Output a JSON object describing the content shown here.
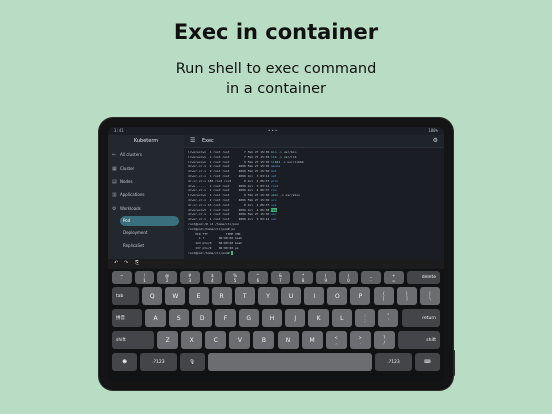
{
  "headline": "Exec in container",
  "subline": [
    "Run shell to exec command",
    "in a container"
  ],
  "status": {
    "time": "3:41",
    "battery": "100%"
  },
  "sidebar": {
    "title": "Kubeterm",
    "items": [
      {
        "icon": "←",
        "label": "All clusters",
        "sub": false
      },
      {
        "icon": "▦",
        "label": "Cluster",
        "sub": false
      },
      {
        "icon": "▤",
        "label": "Nodes",
        "sub": false
      },
      {
        "icon": "▥",
        "label": "Applications",
        "sub": false
      },
      {
        "icon": "⚙",
        "label": "Workloads",
        "sub": false
      },
      {
        "icon": "",
        "label": "Pod",
        "sub": true,
        "active": true
      },
      {
        "icon": "",
        "label": "Deployment",
        "sub": true
      },
      {
        "icon": "",
        "label": "ReplicaSet",
        "sub": true
      }
    ]
  },
  "terminal": {
    "title": "Exec",
    "lines": [
      [
        {
          "t": "lrwxrwxrwx  1 root root        7 Feb 27 15:30 "
        },
        {
          "t": "bin",
          "c": "cyan"
        },
        {
          "t": " -> usr/bin"
        }
      ],
      [
        {
          "t": "lrwxrwxrwx  1 root root        7 Feb 27 15:30 "
        },
        {
          "t": "lib",
          "c": "cyan"
        },
        {
          "t": " -> usr/lib"
        }
      ],
      [
        {
          "t": "lrwxrwxrwx  1 root root        9 Feb 27 15:30 "
        },
        {
          "t": "lib64",
          "c": "cyan"
        },
        {
          "t": " -> usr/lib64"
        }
      ],
      [
        {
          "t": "drwxr-xr-x  2 root root     4096 Feb 27 15:30 "
        },
        {
          "t": "media",
          "c": "blue"
        }
      ],
      [
        {
          "t": "drwxr-xr-x  2 root root     4096 Feb 27 15:30 "
        },
        {
          "t": "mnt",
          "c": "blue"
        }
      ],
      [
        {
          "t": "drwxr-xr-x  1 root root     4096 Jul  3 03:14 "
        },
        {
          "t": "opt",
          "c": "blue"
        }
      ],
      [
        {
          "t": "dr-xr-xr-x 185 root root       0 Jul  4 06:37 "
        },
        {
          "t": "proc",
          "c": "blue"
        }
      ],
      [
        {
          "t": "drwx------  1 root root     4096 Jul  3 03:14 "
        },
        {
          "t": "root",
          "c": "blue"
        }
      ],
      [
        {
          "t": "drwxr-xr-x  1 root root     4096 Jul  4 06:37 "
        },
        {
          "t": "run",
          "c": "blue"
        }
      ],
      [
        {
          "t": "lrwxrwxrwx  1 root root        8 Feb 27 15:30 "
        },
        {
          "t": "sbin",
          "c": "cyan"
        },
        {
          "t": " -> usr/sbin"
        }
      ],
      [
        {
          "t": "drwxr-xr-x  2 root root     4096 Feb 27 15:30 "
        },
        {
          "t": "srv",
          "c": "blue"
        }
      ],
      [
        {
          "t": "dr-xr-xr-x 13 root root        0 Jul  4 06:37 "
        },
        {
          "t": "sys",
          "c": "blue"
        }
      ],
      [
        {
          "t": "drwxrwxrwt  1 root root     4096 Jul  4 06:38 "
        },
        {
          "t": "tmp",
          "c": "hl"
        }
      ],
      [
        {
          "t": "drwxr-xr-x  1 root root     4096 Feb 27 15:30 "
        },
        {
          "t": "usr",
          "c": "blue"
        }
      ],
      [
        {
          "t": "drwxr-xr-x  1 root root     4096 Jul  3 03:14 "
        },
        {
          "t": "var",
          "c": "blue"
        }
      ],
      [
        {
          "t": "root@pod:/# cd /home/cli/pod"
        }
      ],
      [
        {
          "t": "root@pod:/home/cli/pod# ps"
        }
      ],
      [
        {
          "t": "    PID TTY          TIME CMD"
        }
      ],
      [
        {
          "t": "      1 ?        00:00:00 bash"
        }
      ],
      [
        {
          "t": "    124 pts/0    00:00:00 bash"
        }
      ],
      [
        {
          "t": "    137 pts/0    00:00:00 ps"
        }
      ],
      [
        {
          "t": "root@pod:/home/cli/pod# "
        },
        {
          "t": " ",
          "c": "hl"
        }
      ]
    ]
  },
  "keyboard": {
    "toolbar": [
      "↶",
      "↷",
      "⎘"
    ],
    "rows": [
      [
        [
          "~",
          "`"
        ],
        [
          "!",
          "1"
        ],
        [
          "@",
          "2"
        ],
        [
          "#",
          "3"
        ],
        [
          "$",
          "4"
        ],
        [
          "%",
          "5"
        ],
        [
          "^",
          "6"
        ],
        [
          "&",
          "7"
        ],
        [
          "*",
          "8"
        ],
        [
          "(",
          "9"
        ],
        [
          ")",
          "0"
        ],
        [
          "_",
          "-"
        ],
        [
          "+",
          "="
        ],
        [
          "delete"
        ]
      ],
      [
        [
          "tab"
        ],
        [
          "Q"
        ],
        [
          "W"
        ],
        [
          "E"
        ],
        [
          "R"
        ],
        [
          "T"
        ],
        [
          "Y"
        ],
        [
          "U"
        ],
        [
          "I"
        ],
        [
          "O"
        ],
        [
          "P"
        ],
        [
          "{",
          "["
        ],
        [
          "}",
          "]"
        ],
        [
          "|",
          "\\"
        ]
      ],
      [
        [
          "拼音"
        ],
        [
          "A"
        ],
        [
          "S"
        ],
        [
          "D"
        ],
        [
          "F"
        ],
        [
          "G"
        ],
        [
          "H"
        ],
        [
          "J"
        ],
        [
          "K"
        ],
        [
          "L"
        ],
        [
          ":",
          ";"
        ],
        [
          "\"",
          "'"
        ],
        [
          "return"
        ]
      ],
      [
        [
          "shift"
        ],
        [
          "Z"
        ],
        [
          "X"
        ],
        [
          "C"
        ],
        [
          "V"
        ],
        [
          "B"
        ],
        [
          "N"
        ],
        [
          "M"
        ],
        [
          "<",
          ","
        ],
        [
          ">",
          "."
        ],
        [
          "?",
          "/"
        ],
        [
          "shift"
        ]
      ],
      [
        [
          "☻"
        ],
        [
          ".?123"
        ],
        [
          "🎙"
        ],
        [
          " "
        ],
        [
          ".?123"
        ],
        [
          "⌨"
        ]
      ]
    ]
  }
}
